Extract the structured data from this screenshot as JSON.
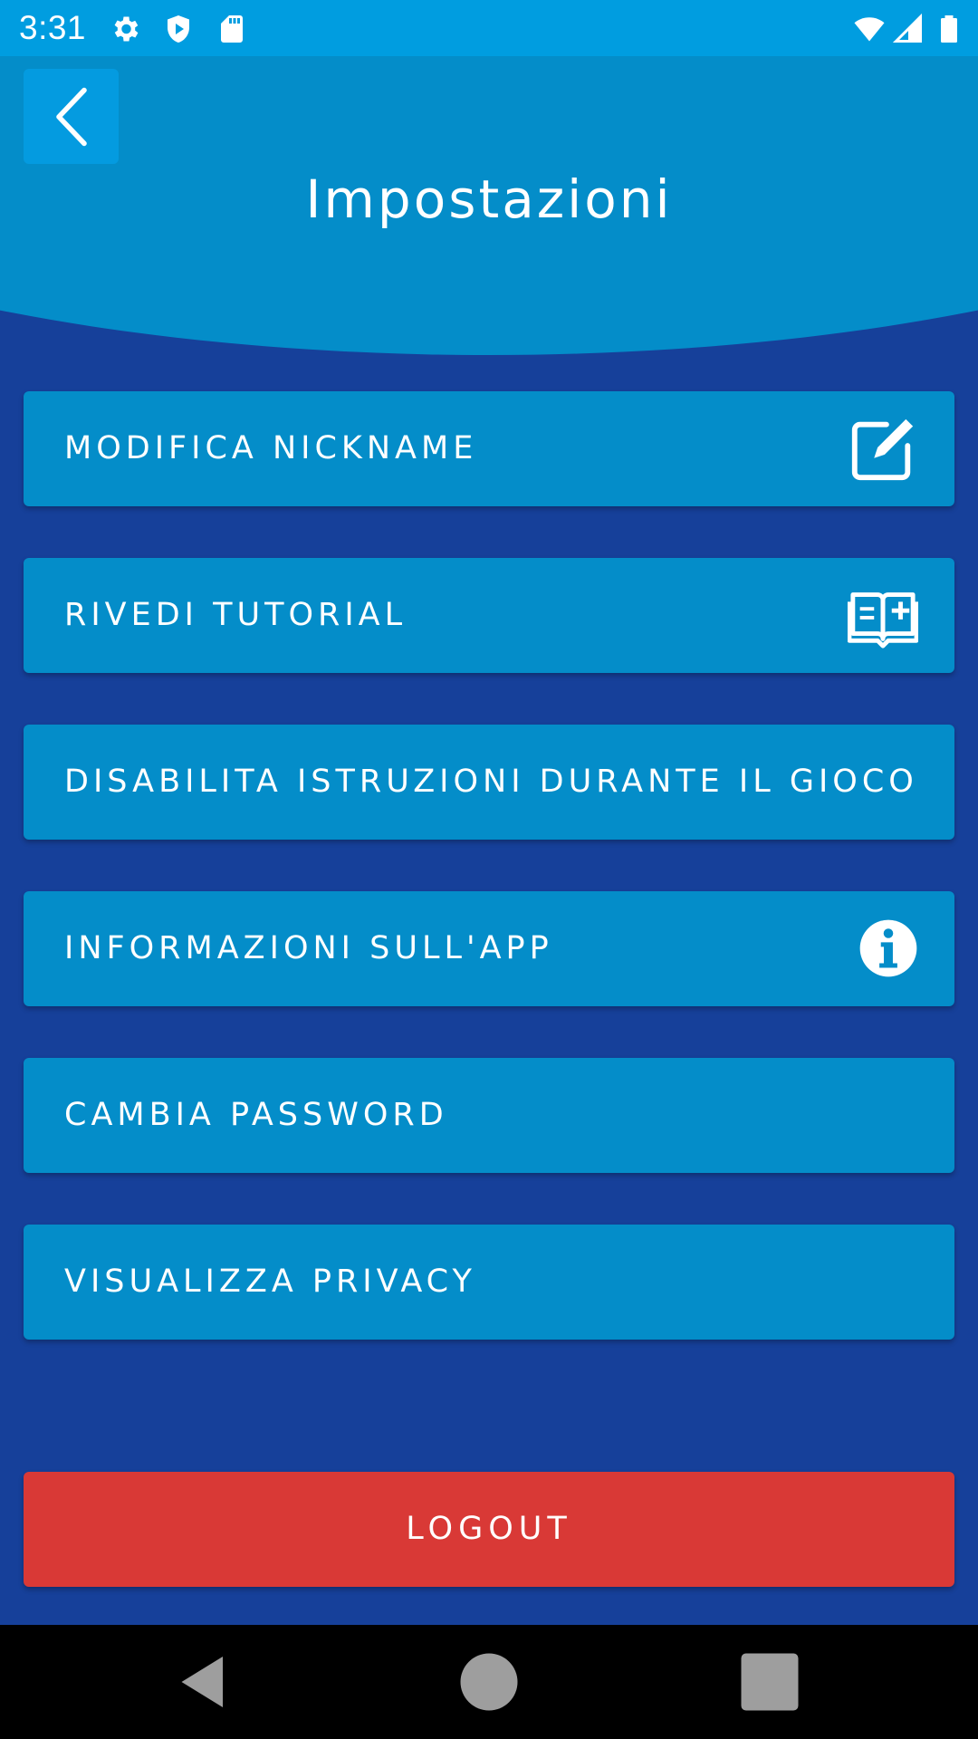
{
  "status_bar": {
    "time": "3:31",
    "icons": [
      "gear-icon",
      "shield-play-icon",
      "sd-card-icon",
      "wifi-icon",
      "signal-icon",
      "battery-icon"
    ]
  },
  "header": {
    "title": "Impostazioni",
    "back_icon": "chevron-left-icon"
  },
  "menu": {
    "items": [
      {
        "label": "MODIFICA NICKNAME",
        "icon": "edit-icon"
      },
      {
        "label": "RIVEDI TUTORIAL",
        "icon": "book-icon"
      },
      {
        "label": "DISABILITA ISTRUZIONI DURANTE IL GIOCO",
        "icon": ""
      },
      {
        "label": "INFORMAZIONI SULL'APP",
        "icon": "info-icon"
      },
      {
        "label": "CAMBIA PASSWORD",
        "icon": ""
      },
      {
        "label": "VISUALIZZA PRIVACY",
        "icon": ""
      }
    ]
  },
  "logout": {
    "label": "LOGOUT"
  },
  "colors": {
    "background": "#16409a",
    "header": "#048dc9",
    "status_bar": "#009de0",
    "button": "#048dc9",
    "logout": "#d93936"
  }
}
